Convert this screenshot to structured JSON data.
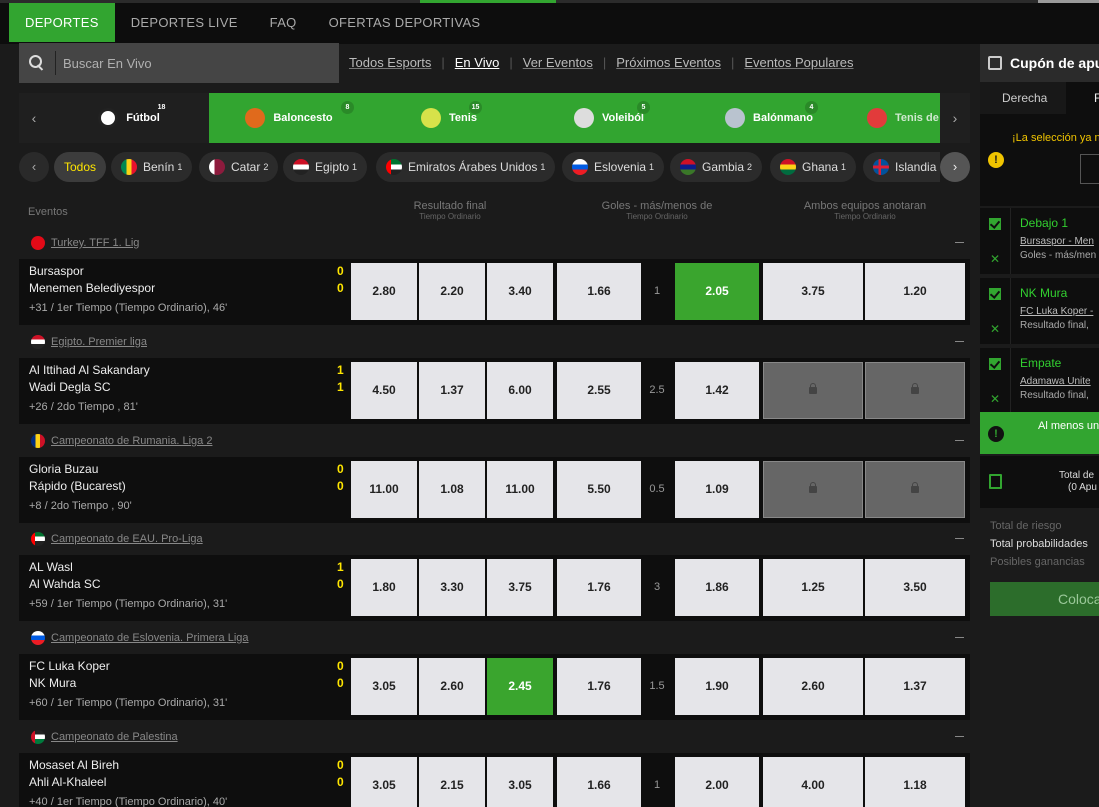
{
  "nav": {
    "items": [
      "DEPORTES",
      "DEPORTES LIVE",
      "FAQ",
      "OFERTAS DEPORTIVAS"
    ]
  },
  "search": {
    "placeholder": "Buscar En Vivo"
  },
  "filters": [
    "Todos Esports",
    "En Vivo",
    "Ver Eventos",
    "Próximos Eventos",
    "Eventos Populares"
  ],
  "sports": [
    {
      "name": "Fútbol",
      "count": "18",
      "color": "#ffffff"
    },
    {
      "name": "Baloncesto",
      "count": "8",
      "color": "#e06a1c"
    },
    {
      "name": "Tenis",
      "count": "15",
      "color": "#d7e24a"
    },
    {
      "name": "Voleiból",
      "count": "5",
      "color": "#dddddd"
    },
    {
      "name": "Balónmano",
      "count": "4",
      "color": "#b9c3cf"
    },
    {
      "name": "Tenis de",
      "count": "",
      "color": "#e23b3b"
    }
  ],
  "countries": [
    {
      "name": "Todos",
      "count": ""
    },
    {
      "name": "Benín",
      "count": "1"
    },
    {
      "name": "Catar",
      "count": "2"
    },
    {
      "name": "Egipto",
      "count": "1"
    },
    {
      "name": "Emiratos Árabes Unidos",
      "count": "1"
    },
    {
      "name": "Eslovenia",
      "count": "1"
    },
    {
      "name": "Gambia",
      "count": "2"
    },
    {
      "name": "Ghana",
      "count": "1"
    },
    {
      "name": "Islandia",
      "count": ""
    }
  ],
  "columns": {
    "events": "Eventos",
    "result": "Resultado final",
    "result_sub": "Tiempo Ordinario",
    "goals": "Goles - más/menos de",
    "goals_sub": "Tiempo Ordinario",
    "btts": "Ambos equipos anotaran",
    "btts_sub": "Tiempo Ordinario"
  },
  "leagues": [
    {
      "name": "Turkey. TFF 1. Lig",
      "flag": "#e30a17",
      "match": {
        "team1": "Bursaspor",
        "team2": "Menemen Belediyespor",
        "score1": "0",
        "score2": "0",
        "status": "+31 / 1er Tiempo (Tiempo Ordinario), 46'",
        "odds": [
          "2.80",
          "2.20",
          "3.40",
          "1.66",
          "1",
          "2.05",
          "3.75",
          "1.20"
        ]
      }
    },
    {
      "name": "Egipto. Premier liga",
      "flag": "#ce1126",
      "match": {
        "team1": "Al Ittihad Al Sakandary",
        "team2": "Wadi Degla SC",
        "score1": "1",
        "score2": "1",
        "status": "+26 / 2do Tiempo , 81'",
        "odds": [
          "4.50",
          "1.37",
          "6.00",
          "2.55",
          "2.5",
          "1.42",
          "",
          ""
        ]
      }
    },
    {
      "name": "Campeonato de Rumania. Liga 2",
      "flag": "#fcd116",
      "match": {
        "team1": "Gloria Buzau",
        "team2": "Rápido (Bucarest)",
        "score1": "0",
        "score2": "0",
        "status": "+8 / 2do Tiempo , 90'",
        "odds": [
          "11.00",
          "1.08",
          "11.00",
          "5.50",
          "0.5",
          "1.09",
          "",
          ""
        ]
      }
    },
    {
      "name": "Campeonato de EAU. Pro-Liga",
      "flag": "#00732f",
      "match": {
        "team1": "AL Wasl",
        "team2": "Al Wahda SC",
        "score1": "1",
        "score2": "0",
        "status": "+59 / 1er Tiempo (Tiempo Ordinario), 31'",
        "odds": [
          "1.80",
          "3.30",
          "3.75",
          "1.76",
          "3",
          "1.86",
          "1.25",
          "3.50"
        ]
      }
    },
    {
      "name": "Campeonato de Eslovenia. Primera Liga",
      "flag": "#005ce5",
      "match": {
        "team1": "FC Luka Koper",
        "team2": "NK Mura",
        "score1": "0",
        "score2": "0",
        "status": "+60 / 1er Tiempo (Tiempo Ordinario), 31'",
        "odds": [
          "3.05",
          "2.60",
          "2.45",
          "1.76",
          "1.5",
          "1.90",
          "2.60",
          "1.37"
        ]
      }
    },
    {
      "name": "Campeonato de Palestina",
      "flag": "#007a3d",
      "match": {
        "team1": "Mosaset Al Bireh",
        "team2": "Ahli Al-Khaleel",
        "score1": "0",
        "score2": "0",
        "status": "+40 / 1er Tiempo (Tiempo Ordinario), 40'",
        "odds": [
          "3.05",
          "2.15",
          "3.05",
          "1.66",
          "1",
          "2.00",
          "4.00",
          "1.18"
        ]
      }
    }
  ],
  "coupon": {
    "title": "Cupón de apue",
    "tab1": "Derecha",
    "tab2": "F",
    "warning": "¡La selección ya n",
    "selections": [
      {
        "pick": "Debajo 1",
        "event": "Bursaspor - Men",
        "market": "Goles - más/men"
      },
      {
        "pick": "NK Mura",
        "event": "FC Luka Koper -",
        "market": "Resultado final, "
      },
      {
        "pick": "Empate",
        "event": "Adamawa Unite",
        "market": "Resultado final, "
      }
    ],
    "min_notice": "Al menos un",
    "total_label": "Total de",
    "total_sub": "(0 Apu",
    "risk_label": "Total de riesgo",
    "odds_label": "Total probabilidades",
    "win_label": "Posibles ganancias",
    "place_label": "Coloca"
  },
  "colors": {
    "accent": "#32a530",
    "score": "#ffe600",
    "warning": "#f0c400"
  }
}
